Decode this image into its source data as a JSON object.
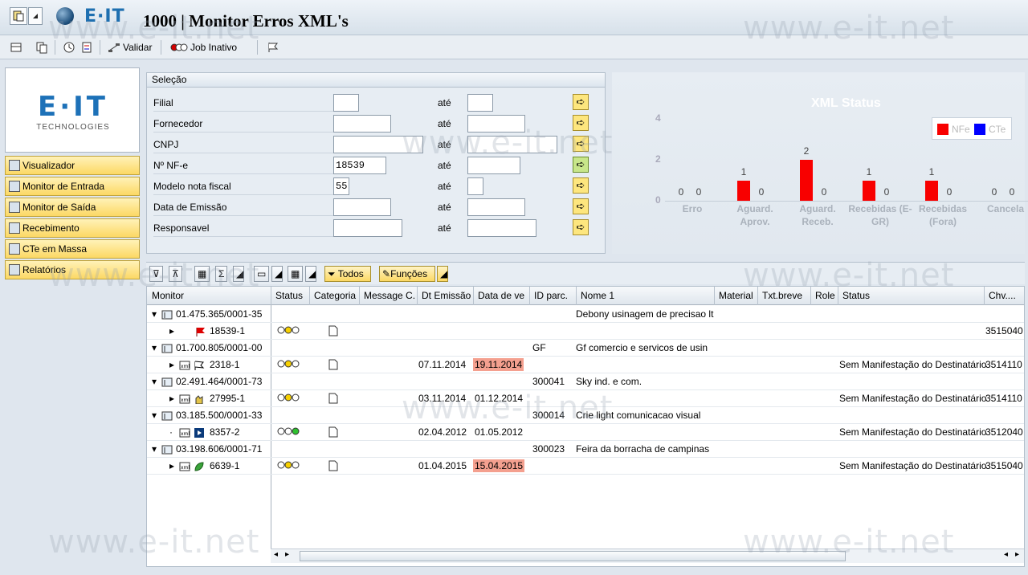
{
  "window": {
    "title": "1000 | Monitor Erros XML's",
    "brand": "E·IT"
  },
  "toolbar": {
    "validate_label": "Validar",
    "job_label": "Job Inativo"
  },
  "logo": {
    "main": "E·IT",
    "sub": "TECHNOLOGIES"
  },
  "nav": [
    {
      "label": "Visualizador",
      "icon": "xml-icon"
    },
    {
      "label": "Monitor de Entrada",
      "icon": "monitor-in-icon"
    },
    {
      "label": "Monitor de Saída",
      "icon": "monitor-out-icon"
    },
    {
      "label": "Recebimento",
      "icon": "receive-icon"
    },
    {
      "label": "CTe em Massa",
      "icon": "truck-icon"
    },
    {
      "label": "Relatórios",
      "icon": "report-icon"
    }
  ],
  "selection": {
    "title": "Seleção",
    "to_label": "até",
    "fields": [
      {
        "label": "Filial",
        "value": ""
      },
      {
        "label": "Fornecedor",
        "value": ""
      },
      {
        "label": "CNPJ",
        "value": ""
      },
      {
        "label": "Nº NF-e",
        "value": "18539"
      },
      {
        "label": "Modelo nota fiscal",
        "value": "55"
      },
      {
        "label": "Data de Emissão",
        "value": ""
      },
      {
        "label": "Responsavel",
        "value": ""
      }
    ]
  },
  "chart_data": {
    "type": "bar",
    "title": "XML Status",
    "ylim": [
      0,
      4
    ],
    "yticks": [
      "0",
      "2",
      "4"
    ],
    "categories": [
      "Erro",
      "Aguard. Aprov.",
      "Aguard. Receb.",
      "Recebidas (E-GR)",
      "Recebidas (Fora)",
      "Cancela"
    ],
    "series": [
      {
        "name": "NFe",
        "color": "#f80000",
        "values": [
          0,
          1,
          2,
          1,
          1,
          0
        ]
      },
      {
        "name": "CTe",
        "color": "#0000ff",
        "values": [
          0,
          0,
          0,
          0,
          0,
          0
        ]
      }
    ],
    "legend": "top-right"
  },
  "gridtoolbar": {
    "all_label": "Todos",
    "functions_label": "Funções"
  },
  "grid": {
    "headers": [
      "Monitor",
      "Status",
      "Categoria",
      "Message C.",
      "Dt Emissão",
      "Data de ve",
      "ID parc.",
      "Nome 1",
      "Material",
      "Txt.breve",
      "Role",
      "Status",
      "Chv...."
    ],
    "rows": [
      {
        "level": 0,
        "monitor": "01.475.365/0001-35",
        "nome": "Debony usinagem de precisao lt"
      },
      {
        "level": 1,
        "monitor": "18539-1",
        "icon": "red-flag-icon",
        "status": "yellow",
        "chv": "3515040"
      },
      {
        "level": 0,
        "monitor": "01.700.805/0001-00",
        "idparc": "GF",
        "nome": "Gf comercio e servicos de usin"
      },
      {
        "level": 1,
        "monitor": "2318-1",
        "icon": "black-flag-icon",
        "status": "yellow",
        "dt": "07.11.2014",
        "venc": "19.11.2014",
        "venc_alert": true,
        "manif": "Sem Manifestação do Destinatário",
        "chv": "3514110"
      },
      {
        "level": 0,
        "monitor": "02.491.464/0001-73",
        "idparc": "300041",
        "nome": "Sky ind. e com."
      },
      {
        "level": 1,
        "monitor": "27995-1",
        "icon": "hand-icon",
        "status": "yellow",
        "dt": "03.11.2014",
        "venc": "01.12.2014",
        "manif": "Sem Manifestação do Destinatário",
        "chv": "3514110"
      },
      {
        "level": 0,
        "monitor": "03.185.500/0001-33",
        "idparc": "300014",
        "nome": "Crie light comunicacao visual"
      },
      {
        "level": 1,
        "monitor": "8357-2",
        "icon": "play-icon",
        "status": "green",
        "dt": "02.04.2012",
        "venc": "01.05.2012",
        "manif": "Sem Manifestação do Destinatário",
        "chv": "3512040"
      },
      {
        "level": 0,
        "monitor": "03.198.606/0001-71",
        "idparc": "300023",
        "nome": "Feira da borracha de campinas"
      },
      {
        "level": 1,
        "monitor": "6639-1",
        "icon": "leaf-icon",
        "status": "yellow",
        "dt": "01.04.2015",
        "venc": "15.04.2015",
        "venc_alert": true,
        "manif": "Sem Manifestação do Destinatário",
        "chv": "3515040"
      }
    ]
  },
  "watermark": "www.e-it.net"
}
